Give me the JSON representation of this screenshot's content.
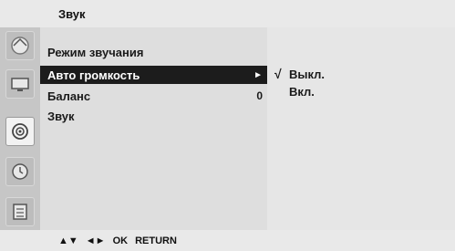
{
  "header": {
    "title": "Звук"
  },
  "sidebar": {
    "icons": [
      {
        "name": "picture-setup-icon"
      },
      {
        "name": "screen-icon"
      },
      {
        "name": "sound-icon",
        "selected": true
      },
      {
        "name": "time-icon"
      },
      {
        "name": "options-icon"
      }
    ]
  },
  "menu": {
    "items": [
      {
        "label": "Режим звучания",
        "value": ""
      },
      {
        "label": "Авто громкость",
        "value": "►",
        "active": true
      },
      {
        "label": "Баланс",
        "value": "0"
      },
      {
        "label": "Звук",
        "value": ""
      }
    ]
  },
  "submenu": {
    "options": [
      {
        "label": "Выкл.",
        "checked": true,
        "check_mark": "√"
      },
      {
        "label": "Вкл.",
        "checked": false,
        "check_mark": ""
      }
    ]
  },
  "footer": {
    "nav_up_down": "▲▼",
    "nav_left_right": "◄►",
    "ok_label": "OK",
    "return_label": "RETURN"
  },
  "colors": {
    "highlight": "#1c1c1c",
    "panel": "#dedede",
    "sidebar": "#c6c6c6"
  }
}
